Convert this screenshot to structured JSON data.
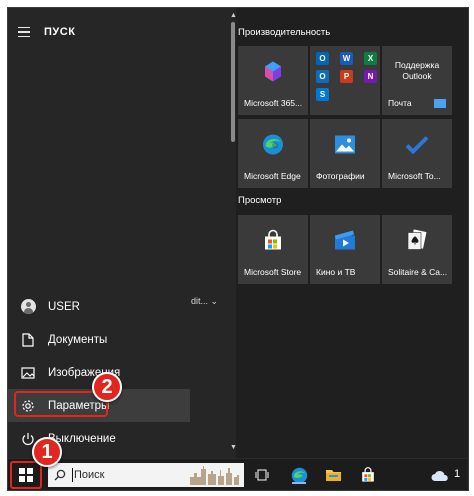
{
  "start_menu": {
    "title": "ПУСК",
    "bottom_items": [
      {
        "label": "USER",
        "icon": "user-avatar-icon"
      },
      {
        "label": "Документы",
        "icon": "document-icon"
      },
      {
        "label": "Изображения",
        "icon": "image-icon"
      },
      {
        "label": "Параметры",
        "icon": "gear-icon",
        "selected": true
      },
      {
        "label": "Выключение",
        "icon": "power-icon"
      }
    ],
    "middle_text": "dit... ⌄"
  },
  "groups": [
    {
      "label": "Производительность",
      "tiles": [
        {
          "label": "Microsoft 365...",
          "icon": "microsoft-365-icon"
        },
        {
          "label": "",
          "icon": "office-apps-grid-icon"
        },
        {
          "label": "Поддержка Outlook",
          "sublabel": "Почта",
          "icon": "mail-icon"
        },
        {
          "label": "Microsoft Edge",
          "icon": "edge-icon"
        },
        {
          "label": "Фотографии",
          "icon": "photos-icon"
        },
        {
          "label": "Microsoft To...",
          "icon": "todo-check-icon"
        }
      ]
    },
    {
      "label": "Просмотр",
      "tiles": [
        {
          "label": "Microsoft Store",
          "icon": "store-icon"
        },
        {
          "label": "Кино и ТВ",
          "icon": "movies-tv-icon"
        },
        {
          "label": "Solitaire & Ca...",
          "icon": "solitaire-cards-icon"
        }
      ]
    }
  ],
  "office_mini_apps": [
    {
      "letter": "O",
      "color": "#0364b8"
    },
    {
      "letter": "W",
      "color": "#185abd"
    },
    {
      "letter": "X",
      "color": "#107c41"
    },
    {
      "letter": "O",
      "color": "#0f6cbd"
    },
    {
      "letter": "P",
      "color": "#c43e1c"
    },
    {
      "letter": "N",
      "color": "#7719aa"
    },
    {
      "letter": "S",
      "color": "#0078d4"
    }
  ],
  "taskbar": {
    "search_placeholder": "Поиск",
    "items": [
      "task-view-icon",
      "edge-icon",
      "file-explorer-icon",
      "store-icon",
      "weather-icon"
    ],
    "clock": "1"
  },
  "callouts": {
    "one": "1",
    "two": "2"
  },
  "colors": {
    "accent_red": "#e5241e",
    "tile_bg": "#3a3a3a",
    "menu_bg": "#262626"
  }
}
